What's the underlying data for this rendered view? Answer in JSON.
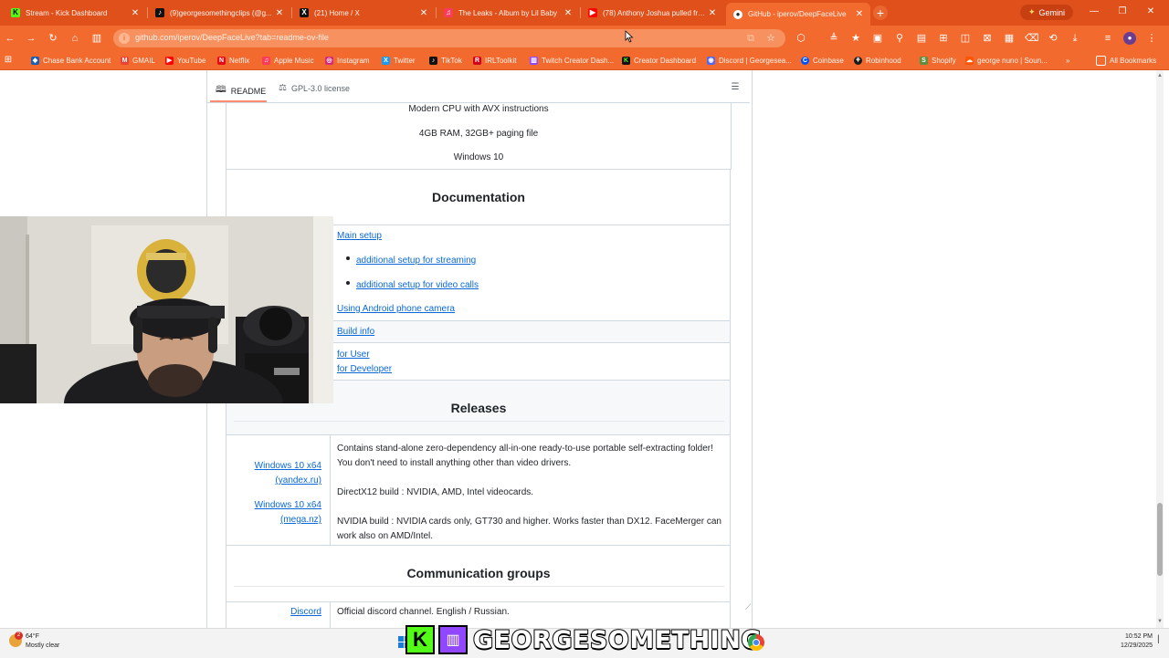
{
  "browser": {
    "tabs": [
      {
        "title": "Stream - Kick Dashboard",
        "favicon": "kick",
        "color": "#53fc18"
      },
      {
        "title": "(9)georgesomethingclips (@g...",
        "favicon": "tiktok",
        "color": "#111111"
      },
      {
        "title": "(21) Home / X",
        "favicon": "x",
        "color": "#111111"
      },
      {
        "title": "The Leaks - Album by Lil Baby",
        "favicon": "apple-music",
        "color": "#fa3c5a"
      },
      {
        "title": "(78) Anthony Joshua pulled fro...",
        "favicon": "youtube",
        "color": "#ff0000"
      },
      {
        "title": "GitHub - iperov/DeepFaceLive",
        "favicon": "github",
        "color": "#ffffff",
        "active": true
      }
    ],
    "gemini_label": "Gemini",
    "url": "github.com/iperov/DeepFaceLive?tab=readme-ov-file",
    "accent": "#f26a2e"
  },
  "bookmarks": [
    {
      "label": "Chase Bank Account",
      "color": "#1a5fb4"
    },
    {
      "label": "GMAIL",
      "color": "#ea4335"
    },
    {
      "label": "YouTube",
      "color": "#ff0000"
    },
    {
      "label": "Netflix",
      "color": "#e50914"
    },
    {
      "label": "Apple Music",
      "color": "#fa3c5a"
    },
    {
      "label": "Instagram",
      "color": "#d62976"
    },
    {
      "label": "Twitter",
      "color": "#1d9bf0"
    },
    {
      "label": "TikTok",
      "color": "#111111"
    },
    {
      "label": "IRLToolkit",
      "color": "#d0021b"
    },
    {
      "label": "Twitch Creator Dash...",
      "color": "#9146ff"
    },
    {
      "label": "Creator Dashboard",
      "color": "#111111"
    },
    {
      "label": "Discord | Georgesea...",
      "color": "#5865f2"
    },
    {
      "label": "Coinbase",
      "color": "#0052ff"
    },
    {
      "label": "Robinhood",
      "color": "#1a1a1a"
    },
    {
      "label": "Shopify",
      "color": "#5e8e3e"
    },
    {
      "label": "george nuno | Soun...",
      "color": "#ff5500"
    }
  ],
  "all_bookmarks_label": "All Bookmarks",
  "readme": {
    "tab_label": "README",
    "license_label": "GPL-3.0 license",
    "requirements": [
      "Modern CPU with AVX instructions",
      "4GB RAM, 32GB+ paging file",
      "Windows 10"
    ],
    "documentation": {
      "heading": "Documentation",
      "main_setup": "Main setup",
      "setup_links": [
        "additional setup for streaming",
        "additional setup for video calls"
      ],
      "android": "Using Android phone camera",
      "build_info": "Build info",
      "for_user": "for User",
      "for_developer": "for Developer"
    },
    "releases": {
      "heading": "Releases",
      "links": [
        {
          "line1": "Windows 10 x64",
          "line2": "(yandex.ru)"
        },
        {
          "line1": "Windows 10 x64",
          "line2": "(mega.nz)"
        }
      ],
      "desc1": "Contains stand-alone zero-dependency all-in-one ready-to-use portable self-extracting folder! You don't need to install anything other than video drivers.",
      "desc2": "DirectX12 build : NVIDIA, AMD, Intel videocards.",
      "desc3": "NVIDIA build : NVIDIA cards only, GT730 and higher. Works faster than DX12. FaceMerger can work also on AMD/Intel."
    },
    "communication": {
      "heading": "Communication groups",
      "discord_label": "Discord",
      "discord_desc": "Official discord channel. English / Russian."
    }
  },
  "taskbar": {
    "weather_temp": "64°F",
    "weather_desc": "Mostly clear",
    "notification_count": "2",
    "time": "10:52 PM",
    "date": "12/29/2025",
    "brand_text": "GEORGESOMETHING"
  }
}
